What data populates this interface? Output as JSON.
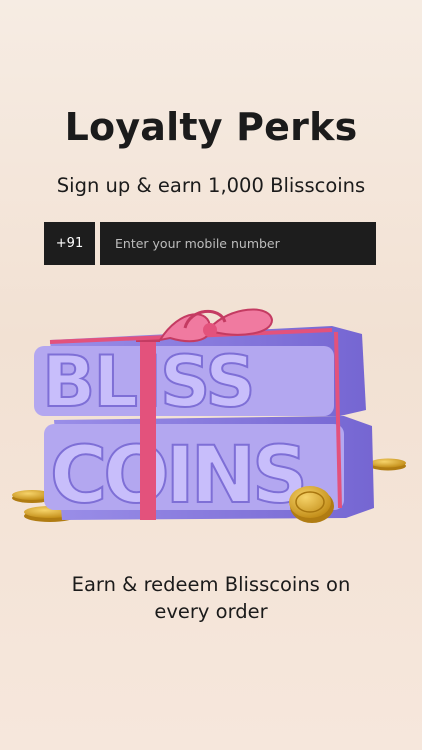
{
  "page": {
    "title": "Loyalty Perks",
    "subtitle": "Sign up & earn 1,000 Blisscoins",
    "footer_line1": "Earn & redeem Blisscoins on",
    "footer_line2": "every order"
  },
  "signup": {
    "country_code": "+91",
    "mobile_placeholder": "Enter your mobile number"
  },
  "hero": {
    "line1": "BLISS",
    "line2": "COINS"
  },
  "colors": {
    "block_face": "#b3a7f0",
    "block_side": "#8a7de0",
    "ribbon": "#e3527c",
    "coin": "#d9a929"
  }
}
